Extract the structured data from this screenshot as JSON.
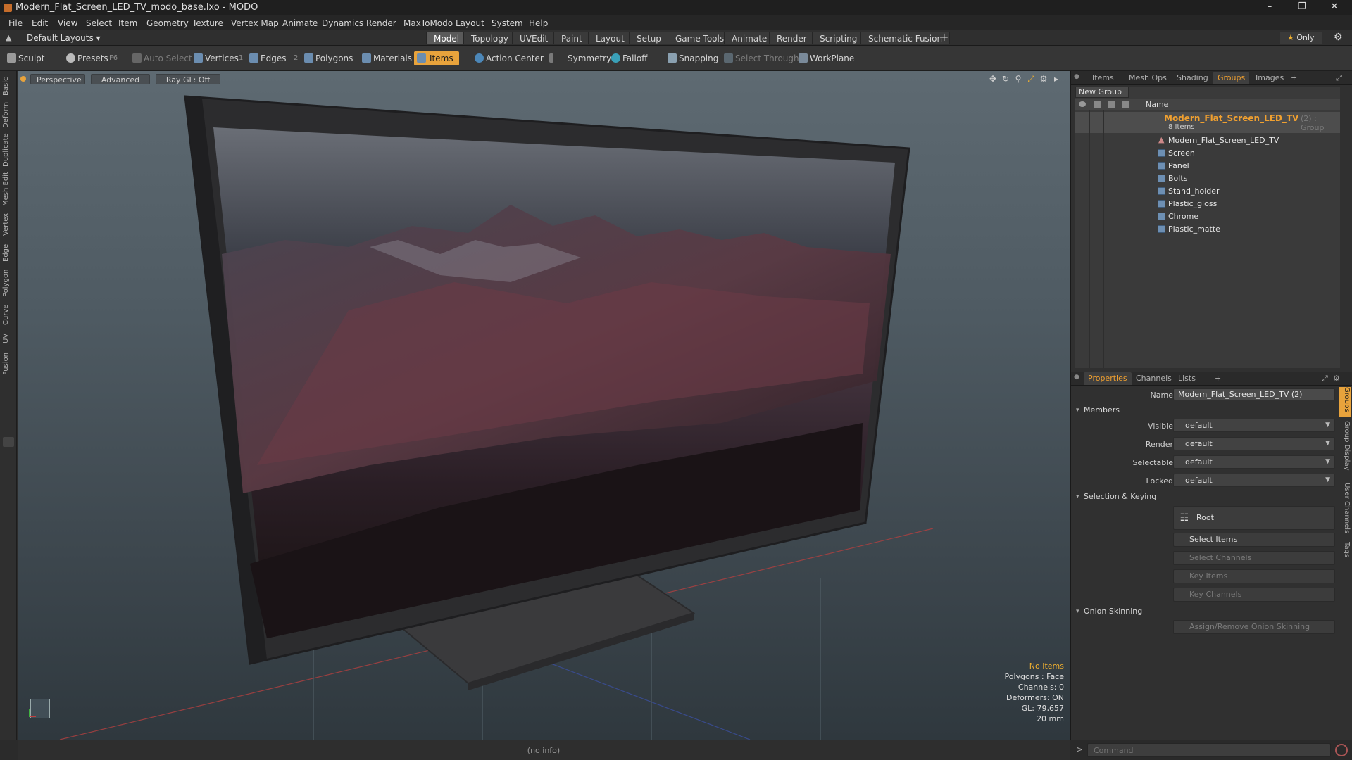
{
  "window": {
    "title": "Modern_Flat_Screen_LED_TV_modo_base.lxo - MODO"
  },
  "menu": [
    "File",
    "Edit",
    "View",
    "Select",
    "Item",
    "Geometry",
    "Texture",
    "Vertex Map",
    "Animate",
    "Dynamics",
    "Render",
    "MaxToModo",
    "Layout",
    "System",
    "Help"
  ],
  "layout_bar": {
    "layouts_label": "Default Layouts",
    "tabs": [
      "Model",
      "Topology",
      "UVEdit",
      "Paint",
      "Layout",
      "Setup",
      "Game Tools",
      "Animate",
      "Render",
      "Scripting",
      "Schematic Fusion"
    ],
    "active_tab": "Model",
    "only_label": "Only"
  },
  "toolbar": {
    "sculpt": "Sculpt",
    "presets": "Presets",
    "presets_key": "F6",
    "auto_select": "Auto Select",
    "vertices": "Vertices",
    "vertices_key": "1",
    "edges": "Edges",
    "edges_key": "2",
    "polygons": "Polygons",
    "materials": "Materials",
    "items": "Items",
    "action_center": "Action Center",
    "symmetry": "Symmetry",
    "falloff": "Falloff",
    "snapping": "Snapping",
    "select_through": "Select Through",
    "workplane": "WorkPlane"
  },
  "left_tabs": [
    "Basic",
    "Deform",
    "Duplicate",
    "Mesh Edit",
    "Vertex",
    "Edge",
    "Polygon",
    "Curve",
    "UV",
    "Fusion"
  ],
  "viewport": {
    "perspective": "Perspective",
    "advanced": "Advanced",
    "raygl": "Ray GL: Off",
    "hud": {
      "no_items": "No Items",
      "polygons": "Polygons : Face",
      "channels": "Channels: 0",
      "deformers": "Deformers: ON",
      "gl": "GL: 79,657",
      "size": "20 mm"
    }
  },
  "status": {
    "info": "(no info)"
  },
  "groups_panel": {
    "tabs": [
      "Items",
      "Mesh Ops",
      "Shading",
      "Groups",
      "Images"
    ],
    "active_tab": "Groups",
    "new_group": "New Group",
    "name_header": "Name",
    "group_name": "Modern_Flat_Screen_LED_TV",
    "group_suffix": "(2) : Group",
    "count": "8 Items",
    "children": [
      "Modern_Flat_Screen_LED_TV",
      "Screen",
      "Panel",
      "Bolts",
      "Stand_holder",
      "Plastic_gloss",
      "Chrome",
      "Plastic_matte"
    ]
  },
  "properties": {
    "tabs": [
      "Properties",
      "Channels",
      "Lists"
    ],
    "active_tab": "Properties",
    "name_label": "Name",
    "name_value": "Modern_Flat_Screen_LED_TV (2)",
    "members": "Members",
    "visible_label": "Visible",
    "visible_value": "default",
    "render_label": "Render",
    "render_value": "default",
    "selectable_label": "Selectable",
    "selectable_value": "default",
    "locked_label": "Locked",
    "locked_value": "default",
    "selection_keying": "Selection & Keying",
    "root": "Root",
    "select_items": "Select Items",
    "select_channels": "Select Channels",
    "key_items": "Key Items",
    "key_channels": "Key Channels",
    "onion": "Onion Skinning",
    "assign_onion": "Assign/Remove Onion Skinning",
    "side_tabs": [
      "Groups",
      "Group Display",
      "User Channels",
      "Tags"
    ]
  },
  "command": {
    "placeholder": "Command"
  },
  "colors": {
    "accent": "#e8a33c",
    "selected_group": "#f0a030"
  }
}
